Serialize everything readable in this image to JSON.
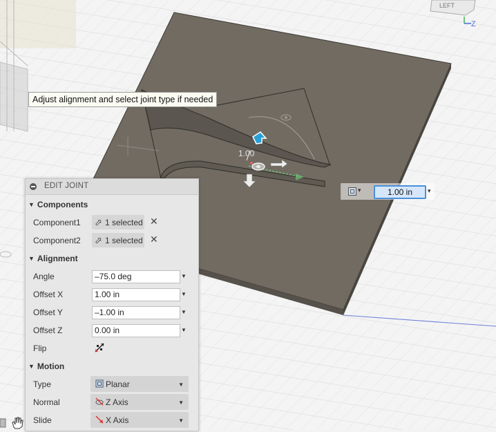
{
  "tooltip": "Adjust alignment and select joint type if needed",
  "viewcube": {
    "face_label": "LEFT",
    "axis_label": "Z"
  },
  "canvas": {
    "manipulator_value": "1.00"
  },
  "floating_input": {
    "value": "1.00 in"
  },
  "panel": {
    "title": "EDIT JOINT",
    "sections": {
      "components": "Components",
      "alignment": "Alignment",
      "motion": "Motion"
    },
    "component1": {
      "label": "Component1",
      "value": "1 selected"
    },
    "component2": {
      "label": "Component2",
      "value": "1 selected"
    },
    "angle": {
      "label": "Angle",
      "value": "–75.0 deg"
    },
    "offset_x": {
      "label": "Offset X",
      "value": "1.00 in"
    },
    "offset_y": {
      "label": "Offset Y",
      "value": "–1.00 in"
    },
    "offset_z": {
      "label": "Offset Z",
      "value": "0.00 in"
    },
    "flip": {
      "label": "Flip"
    },
    "type": {
      "label": "Type",
      "value": "Planar"
    },
    "normal": {
      "label": "Normal",
      "value": "Z Axis"
    },
    "slide": {
      "label": "Slide",
      "value": "X Axis"
    }
  },
  "colors": {
    "plate_top": "#716b62",
    "plate_side": "#4e4a44",
    "accent": "#4a90d9",
    "grid": "#d8d8d8"
  }
}
